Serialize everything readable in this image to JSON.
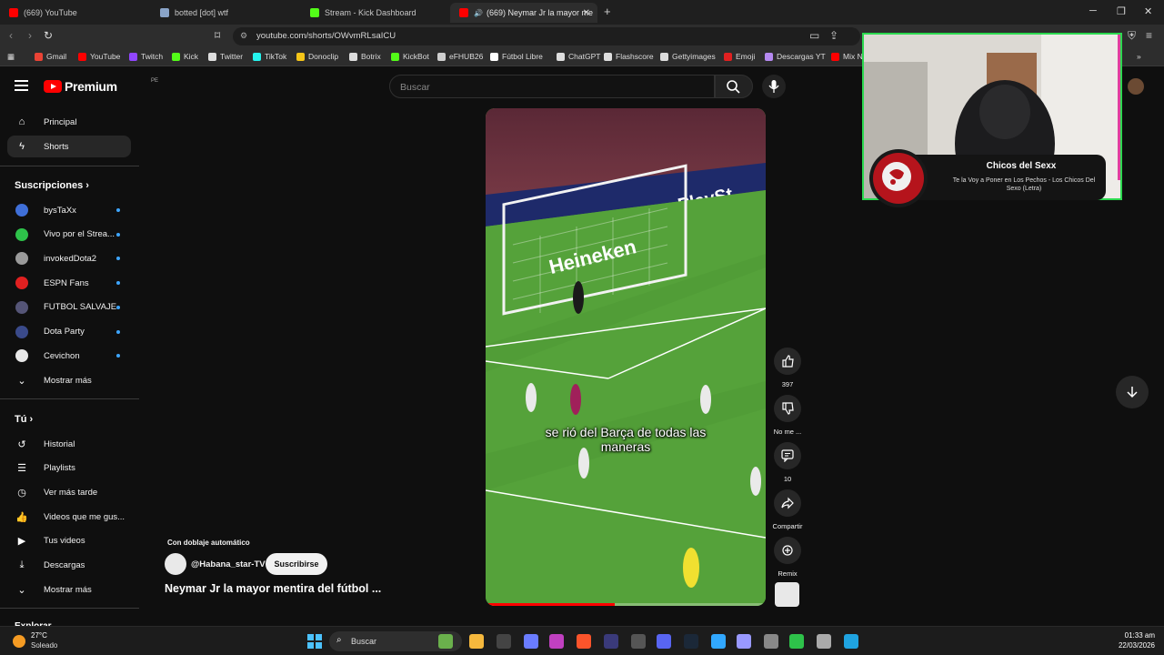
{
  "browser": {
    "tabs": [
      {
        "title": "(669) YouTube",
        "favicon_color": "#ff0000",
        "active": false
      },
      {
        "title": "botted [dot] wtf",
        "favicon_color": "#8aa4c8",
        "active": false
      },
      {
        "title": "Stream - Kick Dashboard",
        "favicon_color": "#53fc18",
        "active": false
      },
      {
        "title": "(669) Neymar Jr la mayor me",
        "favicon_color": "#ff0000",
        "active": true
      }
    ],
    "new_tab": "+",
    "url": "youtube.com/shorts/OWvmRLsaICU",
    "bookmarks": [
      {
        "label": "Gmail",
        "color": "#ea4335"
      },
      {
        "label": "YouTube",
        "color": "#ff0000"
      },
      {
        "label": "Twitch",
        "color": "#9146ff"
      },
      {
        "label": "Kick",
        "color": "#53fc18"
      },
      {
        "label": "Twitter",
        "color": "#dddddd"
      },
      {
        "label": "TikTok",
        "color": "#25f4ee"
      },
      {
        "label": "Donoclip",
        "color": "#f5c518"
      },
      {
        "label": "Botrix",
        "color": "#dddddd"
      },
      {
        "label": "KickBot",
        "color": "#53fc18"
      },
      {
        "label": "eFHUB26",
        "color": "#cfcfcf"
      },
      {
        "label": "Fútbol Libre",
        "color": "#ffffff"
      },
      {
        "label": "ChatGPT",
        "color": "#dddddd"
      },
      {
        "label": "Flashscore",
        "color": "#dddddd"
      },
      {
        "label": "Gettyimages",
        "color": "#dddddd"
      },
      {
        "label": "Emoji",
        "color": "#e02020"
      },
      {
        "label": "Descargas YT",
        "color": "#b589f0"
      },
      {
        "label": "Mix N",
        "color": "#ff0000"
      }
    ]
  },
  "masthead": {
    "logo_text": "Premium",
    "country": "PE",
    "search_placeholder": "Buscar"
  },
  "sidebar": {
    "top": [
      {
        "label": "Principal",
        "icon": "home-icon"
      },
      {
        "label": "Shorts",
        "icon": "shorts-icon",
        "active": true
      }
    ],
    "subscriptions_header": "Suscripciones",
    "subscriptions": [
      {
        "label": "bysTaXx",
        "color": "#3f6fd8"
      },
      {
        "label": "Vivo por el Strea...",
        "color": "#2ec24a"
      },
      {
        "label": "invokedDota2",
        "color": "#9a9a9a"
      },
      {
        "label": "ESPN Fans",
        "color": "#e02020"
      },
      {
        "label": "FUTBOL SALVAJE",
        "color": "#555577"
      },
      {
        "label": "Dota Party",
        "color": "#3a4a8a"
      },
      {
        "label": "Cevichon",
        "color": "#e8e8e8"
      }
    ],
    "show_more": "Mostrar más",
    "you_header": "Tú",
    "you_items": [
      {
        "label": "Historial",
        "icon": "history-icon"
      },
      {
        "label": "Playlists",
        "icon": "playlists-icon"
      },
      {
        "label": "Ver más tarde",
        "icon": "watch-later-icon"
      },
      {
        "label": "Videos que me gus...",
        "icon": "liked-icon"
      },
      {
        "label": "Tus videos",
        "icon": "your-videos-icon"
      },
      {
        "label": "Descargas",
        "icon": "downloads-icon"
      }
    ],
    "show_more_2": "Mostrar más",
    "explore_header": "Explorar"
  },
  "short": {
    "caption_line1": "se rió del Barça de todas las",
    "caption_line2": "maneras",
    "progress": 0.46,
    "dubbing_label": "Con doblaje automático",
    "channel": "@Habana_star-TV",
    "subscribe": "Suscribirse",
    "title": "Neymar Jr la mayor mentira del fútbol ...",
    "actions": {
      "likes": "397",
      "dislike": "No me ...",
      "comments": "10",
      "share": "Compartir",
      "remix": "Remix"
    }
  },
  "overlay": {
    "song": "Chicos del Sexx",
    "artist": "Te la Voy a Poner en Los Pechos - Los Chicos Del Sexo (Letra)"
  },
  "taskbar": {
    "temp": "27°C",
    "weather": "Soleado",
    "search": "Buscar",
    "time": "01:33 am",
    "date": "22/03/2026"
  }
}
